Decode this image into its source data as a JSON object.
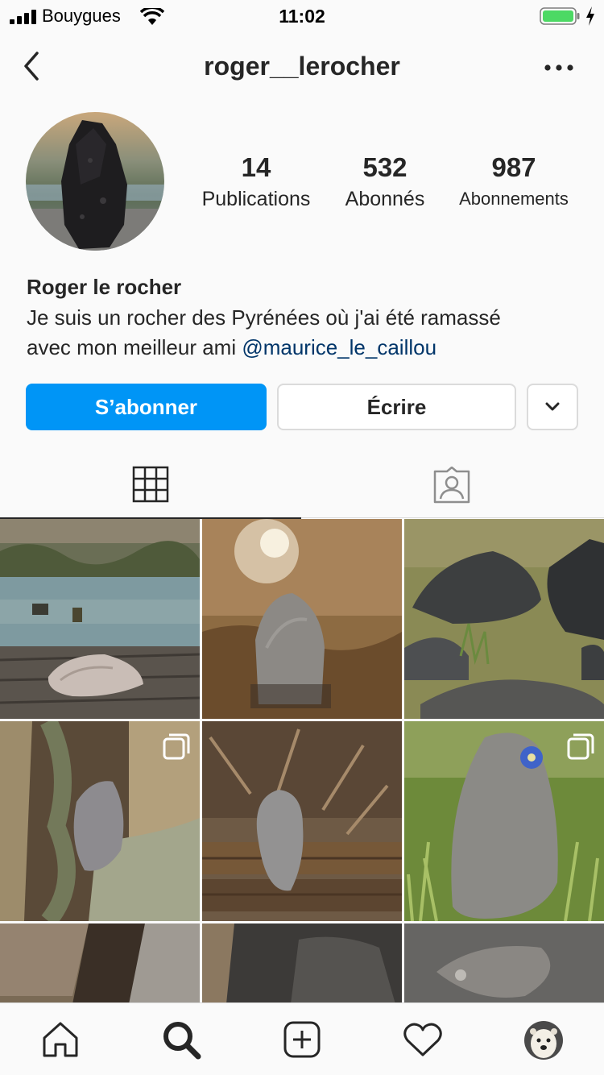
{
  "status_bar": {
    "carrier": "Bouygues",
    "time": "11:02"
  },
  "nav": {
    "username": "roger__lerocher"
  },
  "profile": {
    "stats": [
      {
        "value": "14",
        "label": "Publications"
      },
      {
        "value": "532",
        "label": "Abonnés"
      },
      {
        "value": "987",
        "label": "Abonnements"
      }
    ],
    "name": "Roger le rocher",
    "bio_line1": "Je suis un rocher des Pyrénées où j'ai été ramassé",
    "bio_line2_prefix": "avec mon meilleur ami ",
    "bio_mention": "@maurice_le_caillou"
  },
  "actions": {
    "follow_label": "S’abonner",
    "message_label": "Écrire"
  },
  "colors": {
    "accent": "#0095f6",
    "mention": "#003569",
    "battery": "#4cd964",
    "text": "#262626",
    "border": "#dbdbdb"
  },
  "icons": {
    "tab_grid": "grid-icon",
    "tab_tagged": "tagged-icon",
    "home": "home-icon",
    "search": "search-icon",
    "add": "add-post-icon",
    "activity": "heart-icon",
    "profile": "profile-avatar"
  }
}
